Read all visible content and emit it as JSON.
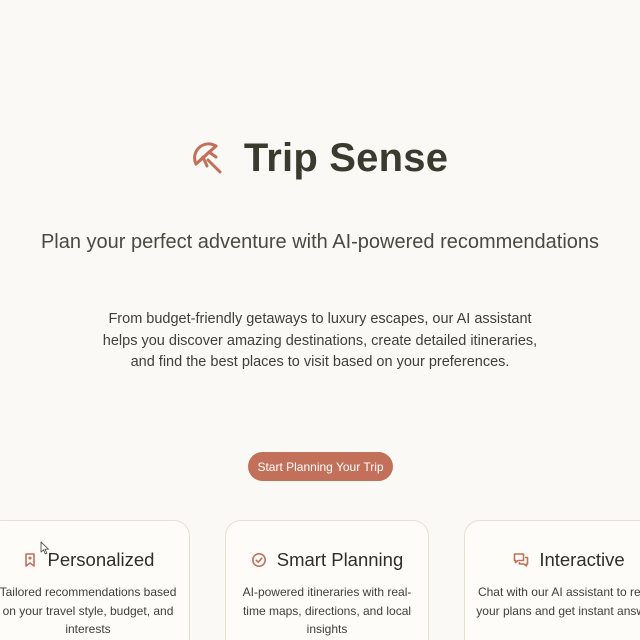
{
  "app": {
    "title": "Trip Sense",
    "logo_icon": "umbrella-icon",
    "accent_color": "#c2705a",
    "background_color": "#fbf9f5"
  },
  "hero": {
    "tagline": "Plan your perfect adventure with AI-powered recommendations",
    "description": "From budget-friendly getaways to luxury escapes, our AI assistant helps you discover amazing destinations, create detailed itineraries, and find the best places to visit based on your preferences.",
    "cta_label": "Start Planning Your Trip"
  },
  "features": [
    {
      "icon": "bookmark-icon",
      "title": "Personalized",
      "description": "Tailored recommendations based on your travel style, budget, and interests"
    },
    {
      "icon": "check-circle-icon",
      "title": "Smart Planning",
      "description": "AI-powered itineraries with real-time maps, directions, and local insights"
    },
    {
      "icon": "chat-icon",
      "title": "Interactive",
      "description": "Chat with our AI assistant to refine your plans and get instant answers"
    }
  ]
}
